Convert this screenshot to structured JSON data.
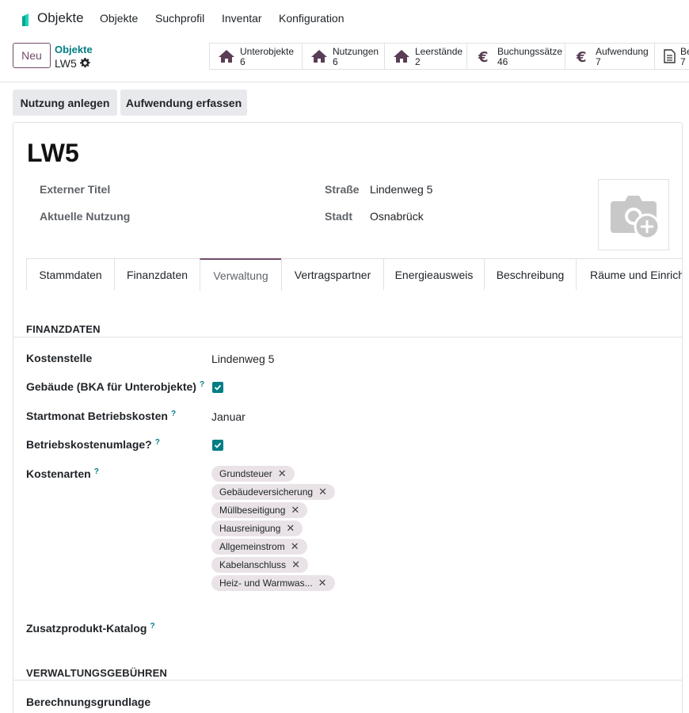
{
  "navbar": {
    "app_name": "Objekte",
    "menu": [
      "Objekte",
      "Suchprofil",
      "Inventar",
      "Konfiguration"
    ]
  },
  "control_panel": {
    "new_label": "Neu",
    "breadcrumb_parent": "Objekte",
    "breadcrumb_current": "LW5",
    "smart_buttons": [
      {
        "label": "Unterobjekte",
        "count": "6",
        "icon": "home-icon"
      },
      {
        "label": "Nutzungen",
        "count": "6",
        "icon": "home-icon"
      },
      {
        "label": "Leerstände",
        "count": "2",
        "icon": "home-icon"
      },
      {
        "label": "Buchungssätze",
        "count": "46",
        "icon": "euro-icon"
      },
      {
        "label": "Aufwendung",
        "count": "7",
        "icon": "euro-icon"
      },
      {
        "label": "Be",
        "count": "7",
        "icon": "document-icon"
      }
    ]
  },
  "actions": {
    "create_usage": "Nutzung anlegen",
    "record_expense": "Aufwendung erfassen"
  },
  "record": {
    "title": "LW5",
    "external_title_label": "Externer Titel",
    "current_usage_label": "Aktuelle Nutzung",
    "street_label": "Straße",
    "street_value": "Lindenweg 5",
    "city_label": "Stadt",
    "city_value": "Osnabrück"
  },
  "tabs": [
    "Stammdaten",
    "Finanzdaten",
    "Verwaltung",
    "Vertragspartner",
    "Energieausweis",
    "Beschreibung",
    "Räume und Einricht"
  ],
  "active_tab": "Verwaltung",
  "finance": {
    "section_title": "FINANZDATEN",
    "cost_center_label": "Kostenstelle",
    "cost_center_value": "Lindenweg 5",
    "building_label": "Gebäude (BKA für Unterobjekte)",
    "building_checked": true,
    "start_month_label": "Startmonat Betriebskosten",
    "start_month_value": "Januar",
    "allocation_label": "Betriebskostenumlage?",
    "allocation_checked": true,
    "cost_types_label": "Kostenarten",
    "cost_types": [
      "Grundsteuer",
      "Gebäudeversicherung",
      "Müllbeseitigung",
      "Hausreinigung",
      "Allgemeinstrom",
      "Kabelanschluss",
      "Heiz- und Warmwas..."
    ],
    "catalog_label": "Zusatzprodukt-Katalog",
    "help_mark": "?"
  },
  "admin_fees": {
    "section_title": "VERWALTUNGSGEBÜHREN",
    "basis_label": "Berechnungsgrundlage"
  },
  "colors": {
    "brand": "#714b67",
    "accent": "#017e84",
    "tag_bg": "#e9e3e7"
  }
}
